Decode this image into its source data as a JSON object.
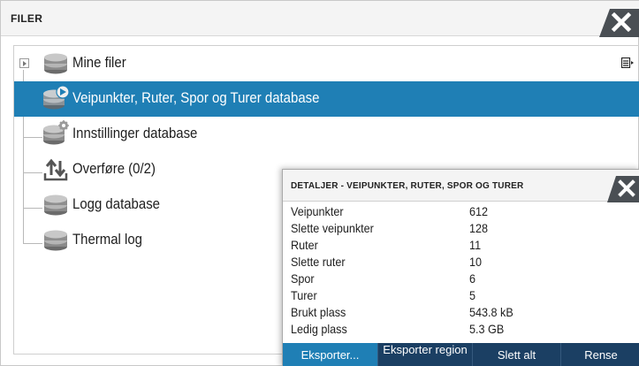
{
  "window": {
    "title": "FILER"
  },
  "tree": {
    "items": [
      {
        "label": "Mine filer",
        "icon": "database-icon"
      },
      {
        "label": "Veipunkter, Ruter, Spor og Turer database",
        "icon": "database-route-icon",
        "selected": true
      },
      {
        "label": "Innstillinger database",
        "icon": "database-settings-icon"
      },
      {
        "label": "Overføre (0/2)",
        "icon": "transfer-icon"
      },
      {
        "label": "Logg database",
        "icon": "database-icon"
      },
      {
        "label": "Thermal log",
        "icon": "database-icon"
      }
    ]
  },
  "details": {
    "title": "DETALJER - VEIPUNKTER, RUTER, SPOR OG TURER",
    "rows": [
      {
        "key": "Veipunkter",
        "value": "612"
      },
      {
        "key": "Slette veipunkter",
        "value": "128"
      },
      {
        "key": "Ruter",
        "value": "11"
      },
      {
        "key": "Slette ruter",
        "value": "10"
      },
      {
        "key": "Spor",
        "value": "6"
      },
      {
        "key": "Turer",
        "value": "5"
      },
      {
        "key": "Brukt plass",
        "value": "543.8 kB"
      },
      {
        "key": "Ledig plass",
        "value": "5.3 GB"
      }
    ],
    "buttons": {
      "export": "Eksporter...",
      "export_region": "Eksporter region",
      "delete_all": "Slett alt",
      "clean": "Rense"
    }
  },
  "colors": {
    "selection": "#1f7fb5",
    "button_bar": "#1b3f63",
    "close_tab": "#4a4f54"
  }
}
